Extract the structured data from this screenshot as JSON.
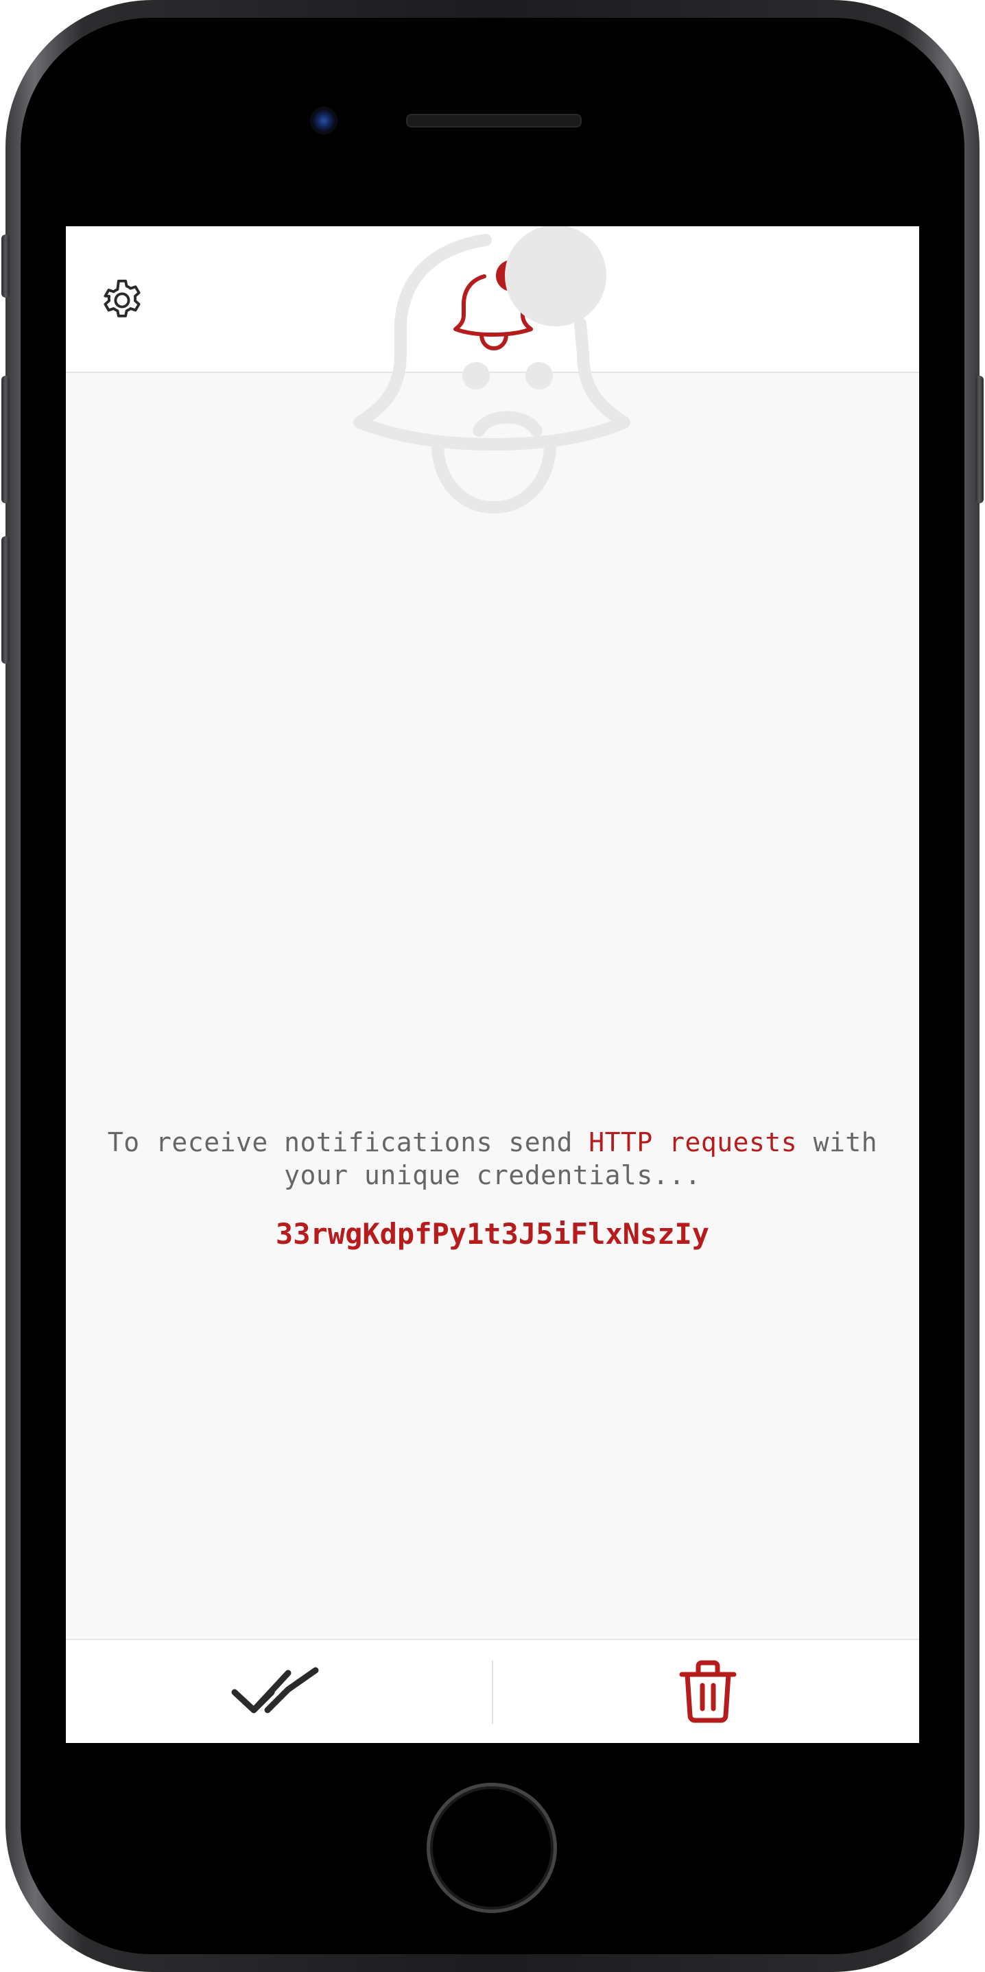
{
  "header": {
    "settings_icon": "gear-icon",
    "logo_icon": "bell-notification-icon"
  },
  "empty_state": {
    "illustration_icon": "sad-bell-icon",
    "hint_prefix": "To receive notifications send ",
    "hint_link": "HTTP requests",
    "hint_suffix": " with your unique credentials...",
    "credentials": "33rwgKdpfPy1t3J5iFlxNszIy"
  },
  "footer": {
    "mark_all_read_icon": "double-check-icon",
    "delete_all_icon": "trash-icon"
  },
  "colors": {
    "accent": "#b71c1c",
    "text": "#666666",
    "background": "#f8f8f8",
    "illustration": "#e8e8e8"
  }
}
